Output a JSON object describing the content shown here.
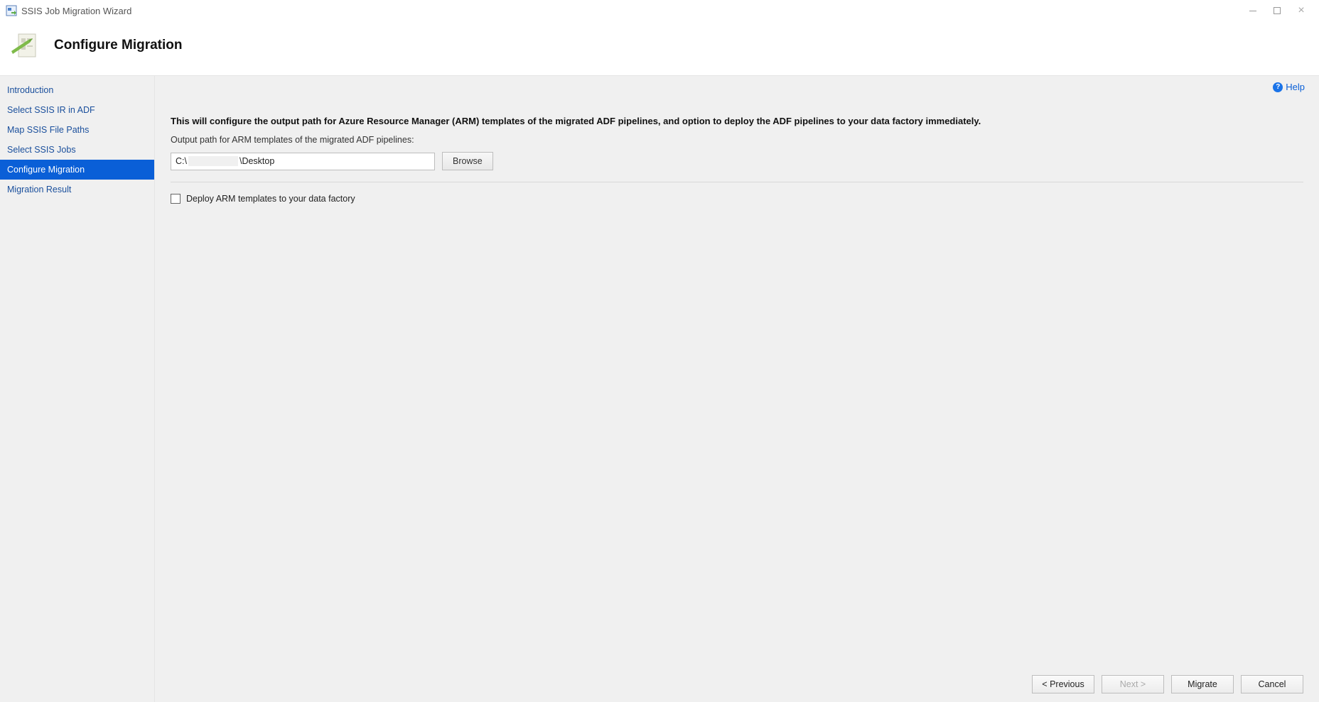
{
  "titlebar": {
    "title": "SSIS Job Migration Wizard"
  },
  "header": {
    "page_title": "Configure Migration"
  },
  "sidebar": {
    "items": [
      {
        "label": "Introduction",
        "active": false
      },
      {
        "label": "Select SSIS IR in ADF",
        "active": false
      },
      {
        "label": "Map SSIS File Paths",
        "active": false
      },
      {
        "label": "Select SSIS Jobs",
        "active": false
      },
      {
        "label": "Configure Migration",
        "active": true
      },
      {
        "label": "Migration Result",
        "active": false
      }
    ]
  },
  "main": {
    "help_label": "Help",
    "description": "This will configure the output path for Azure Resource Manager (ARM) templates of the migrated ADF pipelines, and option to deploy the ADF pipelines to your data factory immediately.",
    "output_path_label": "Output path for ARM templates of the migrated ADF pipelines:",
    "output_path_prefix": "C:\\",
    "output_path_suffix": "\\Desktop",
    "browse_label": "Browse",
    "deploy_checkbox_label": "Deploy ARM templates to your data factory"
  },
  "footer": {
    "previous_label": "< Previous",
    "next_label": "Next >",
    "migrate_label": "Migrate",
    "cancel_label": "Cancel"
  }
}
